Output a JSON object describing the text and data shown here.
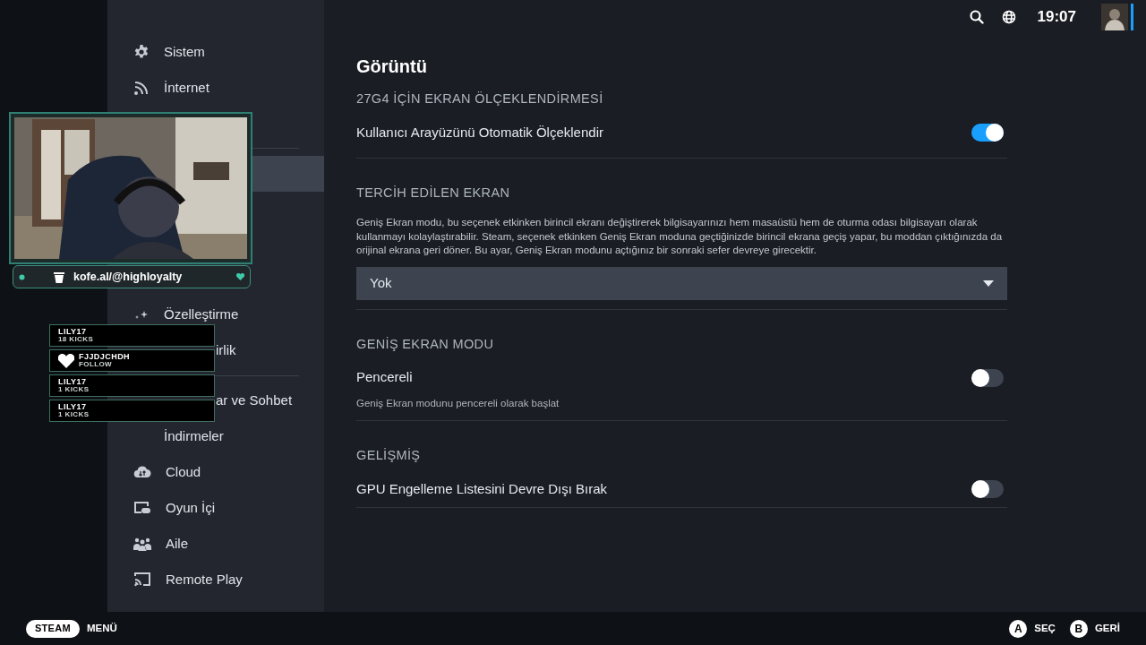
{
  "top_bar": {
    "time": "19:07"
  },
  "sidebar": {
    "items": [
      {
        "label": "Sistem",
        "selected": false
      },
      {
        "label": "İnternet",
        "selected": false
      },
      {
        "selected": true
      },
      {
        "label": "Özelleştirme",
        "selected": false
      },
      {
        "label": "irlik",
        "selected": false
      },
      {
        "label": "ar ve Sohbet",
        "selected": false
      },
      {
        "label": "İndirmeler",
        "selected": false
      },
      {
        "label": "Cloud",
        "selected": false
      },
      {
        "label": "Oyun İçi",
        "selected": false
      },
      {
        "label": "Aile",
        "selected": false
      },
      {
        "label": "Remote Play",
        "selected": false
      }
    ]
  },
  "overlay": {
    "link": "kofe.al/@highloyalty",
    "alerts": [
      {
        "name": "LILY17",
        "detail": "18 KICKS",
        "kind": "kick"
      },
      {
        "name": "FJJDJCHDH",
        "detail": "FOLLOW",
        "kind": "follow"
      },
      {
        "name": "LILY17",
        "detail": "1 KICKS",
        "kind": "kick"
      },
      {
        "name": "LILY17",
        "detail": "1 KICKS",
        "kind": "kick"
      }
    ]
  },
  "content": {
    "title": "Görüntü",
    "sections": [
      {
        "heading": "27G4 İÇİN EKRAN ÖLÇEKLENDİRMESİ",
        "rows": [
          {
            "kind": "toggle",
            "label": "Kullanıcı Arayüzünü Otomatik Ölçeklendir",
            "on": true
          }
        ]
      },
      {
        "heading": "TERCİH EDİLEN EKRAN",
        "rows": [
          {
            "kind": "text",
            "text": "Geniş Ekran modu, bu seçenek etkinken birincil ekranı değiştirerek bilgisayarınızı hem masaüstü hem de oturma odası bilgisayarı olarak kullanmayı kolaylaştırabilir. Steam, seçenek etkinken Geniş Ekran moduna geçtiğinizde birincil ekrana geçiş yapar, bu moddan çıktığınızda da orijinal ekrana geri döner. Bu ayar, Geniş Ekran modunu açtığınız bir sonraki sefer devreye girecektir."
          },
          {
            "kind": "dropdown",
            "value": "Yok"
          }
        ]
      },
      {
        "heading": "GENİŞ EKRAN MODU",
        "rows": [
          {
            "kind": "toggle",
            "label": "Pencereli",
            "on": false,
            "description": "Geniş Ekran modunu pencereli olarak başlat"
          }
        ]
      },
      {
        "heading": "GELİŞMİŞ",
        "rows": [
          {
            "kind": "toggle",
            "label": "GPU Engelleme Listesini Devre Dışı Bırak",
            "on": false
          }
        ]
      }
    ]
  },
  "footer": {
    "left": [
      {
        "key": "STEAM",
        "label": "MENÜ"
      }
    ],
    "right": [
      {
        "key": "A",
        "label": "SEÇ"
      },
      {
        "key": "B",
        "label": "GERİ"
      }
    ]
  }
}
